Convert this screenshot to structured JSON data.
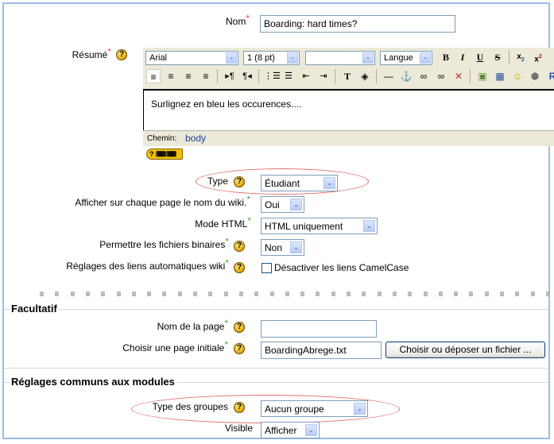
{
  "general": {
    "name": {
      "label": "Nom",
      "value": "Boarding: hard times?"
    },
    "summary": {
      "label": "Résumé",
      "editor": {
        "font_family": "Arial",
        "font_size": "1 (8 pt)",
        "style": "",
        "language": "Langue",
        "toolbar_row1": [
          "bold",
          "italic",
          "underline",
          "strikethrough",
          "subscript",
          "superscript"
        ],
        "toolbar_row2": [
          "align-left",
          "align-center",
          "align-right",
          "justify",
          "ltr",
          "rtl",
          "ordered-list",
          "unordered-list",
          "outdent",
          "indent",
          "text-color",
          "background-color",
          "horizontal-rule",
          "anchor",
          "link",
          "unlink",
          "no-link",
          "image",
          "table",
          "smiley",
          "special-chars"
        ],
        "content": "Surlignez en bleu les occurences....",
        "path_label": "Chemin:",
        "path_value": "body"
      }
    },
    "type": {
      "label": "Type",
      "value": "Étudiant"
    },
    "show_name": {
      "label": "Afficher sur chaque page le nom du wiki.",
      "value": "Oui"
    },
    "html_mode": {
      "label": "Mode HTML",
      "value": "HTML uniquement"
    },
    "binary_files": {
      "label": "Permettre les fichiers binaires",
      "value": "Non"
    },
    "wiki_links": {
      "label": "Réglages des liens automatiques wiki",
      "checkbox_label": "Désactiver les liens CamelCase",
      "checked": false
    }
  },
  "optional": {
    "legend": "Facultatif",
    "page_name": {
      "label": "Nom de la page",
      "value": ""
    },
    "initial_page": {
      "label": "Choisir une page initiale",
      "value": "BoardingAbrege.txt",
      "button": "Choisir ou déposer un fichier ..."
    }
  },
  "common": {
    "legend": "Réglages communs aux modules",
    "group_type": {
      "label": "Type des groupes",
      "value": "Aucun groupe"
    },
    "visible": {
      "label": "Visible",
      "value": "Afficher"
    }
  },
  "symbols": {
    "required": "*",
    "help": "?",
    "dropdown": "⌄"
  }
}
